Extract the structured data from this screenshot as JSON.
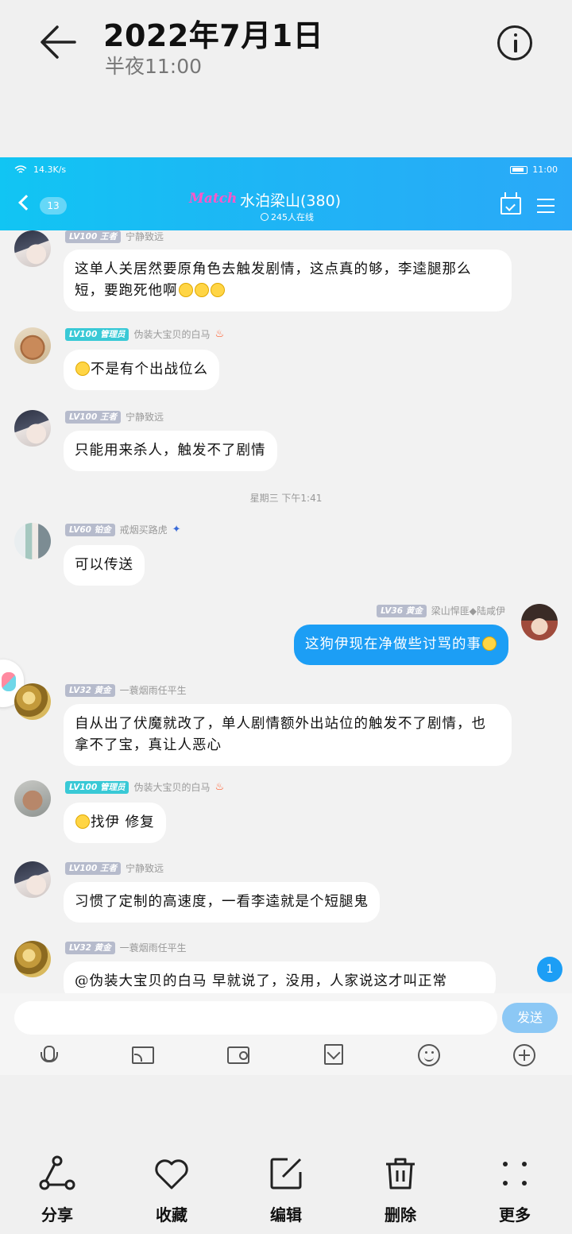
{
  "header": {
    "title": "2022年7月1日",
    "subtitle": "半夜11:00"
  },
  "qq": {
    "status_left": "14.3K/s",
    "status_time": "11:00",
    "unread": "13",
    "logo_text": "Match",
    "group_name": "水泊梁山(380)",
    "online": "245人在线"
  },
  "messages": [
    {
      "level": "LV100 王者",
      "name": "宁静致远",
      "text": "这单人关居然要原角色去触发剧情，这点真的够，李逵腿那么短，要跑死他啊",
      "emoji_count": 3
    },
    {
      "level": "LV100 管理员",
      "name": "伪装大宝贝的白马",
      "text": "不是有个出战位么"
    },
    {
      "level": "LV100 王者",
      "name": "宁静致远",
      "text": "只能用来杀人，触发不了剧情"
    },
    {
      "level": "LV60 铂金",
      "name": "戒烟买路虎",
      "text": "可以传送"
    },
    {
      "level": "LV36 黄金",
      "name": "梁山悍匪◆陆咸伊",
      "text": "这狗伊现在净做些讨骂的事"
    },
    {
      "level": "LV32 黄金",
      "name": "一蓑烟雨任平生",
      "text": "自从出了伏魔就改了，单人剧情额外出站位的触发不了剧情，也拿不了宝，真让人恶心"
    },
    {
      "level": "LV100 管理员",
      "name": "伪装大宝贝的白马",
      "text": "找伊 修复"
    },
    {
      "level": "LV100 王者",
      "name": "宁静致远",
      "text": "习惯了定制的高速度，一看李逵就是个短腿鬼"
    },
    {
      "level": "LV32 黄金",
      "name": "一蓑烟雨任平生",
      "text": "@伪装大宝贝的白马 早就说了，没用，人家说这才叫正常"
    }
  ],
  "timestamp": "星期三 下午1:41",
  "new_count": "1",
  "send_label": "发送",
  "actions": {
    "share": "分享",
    "favorite": "收藏",
    "edit": "编辑",
    "delete": "删除",
    "more": "更多"
  },
  "colors": {
    "accent": "#1c9ef5",
    "header_gradient_start": "#11c5f3",
    "admin_badge": "#39c9d6"
  }
}
